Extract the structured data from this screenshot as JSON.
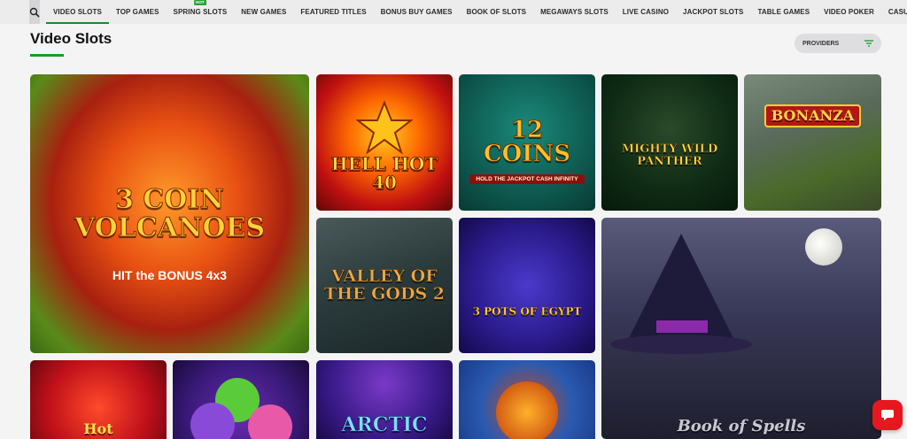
{
  "nav": {
    "items": [
      {
        "label": "VIDEO SLOTS",
        "active": true
      },
      {
        "label": "TOP GAMES"
      },
      {
        "label": "SPRING SLOTS",
        "badge": "HOT"
      },
      {
        "label": "NEW GAMES"
      },
      {
        "label": "FEATURED TITLES"
      },
      {
        "label": "BONUS BUY GAMES"
      },
      {
        "label": "BOOK OF SLOTS"
      },
      {
        "label": "MEGAWAYS SLOTS"
      },
      {
        "label": "LIVE CASINO"
      },
      {
        "label": "JACKPOT SLOTS"
      },
      {
        "label": "TABLE GAMES"
      },
      {
        "label": "VIDEO POKER"
      },
      {
        "label": "CASUAL GAMES"
      }
    ],
    "search_icon": "search-icon"
  },
  "page": {
    "title": "Video Slots",
    "providers_label": "PROVIDERS",
    "filter_icon": "filter-icon",
    "accent_color": "#1a9a2a"
  },
  "games": {
    "volcanoes": {
      "title": "3 COIN VOLCANOES",
      "subtitle": "HIT the BONUS 4x3"
    },
    "hellhot": {
      "title": "HELL HOT 40"
    },
    "coins": {
      "title": "12 COINS",
      "subtitle": "HOLD THE JACKPOT CASH INFINITY"
    },
    "panther": {
      "title": "MIGHTY WILD PANTHER"
    },
    "bonanza": {
      "title": "BONANZA"
    },
    "valley": {
      "title": "VALLEY OF THE GODS 2"
    },
    "egypt": {
      "title": "3 POTS OF EGYPT"
    },
    "witch": {
      "title": "Book of Spells"
    },
    "hot2": {
      "title": "Hot"
    },
    "monster": {
      "title": ""
    },
    "arctic": {
      "title": "ARCTIC"
    },
    "dragon": {
      "title": ""
    }
  },
  "chat": {
    "icon": "chat-icon",
    "color": "#e8161e"
  }
}
